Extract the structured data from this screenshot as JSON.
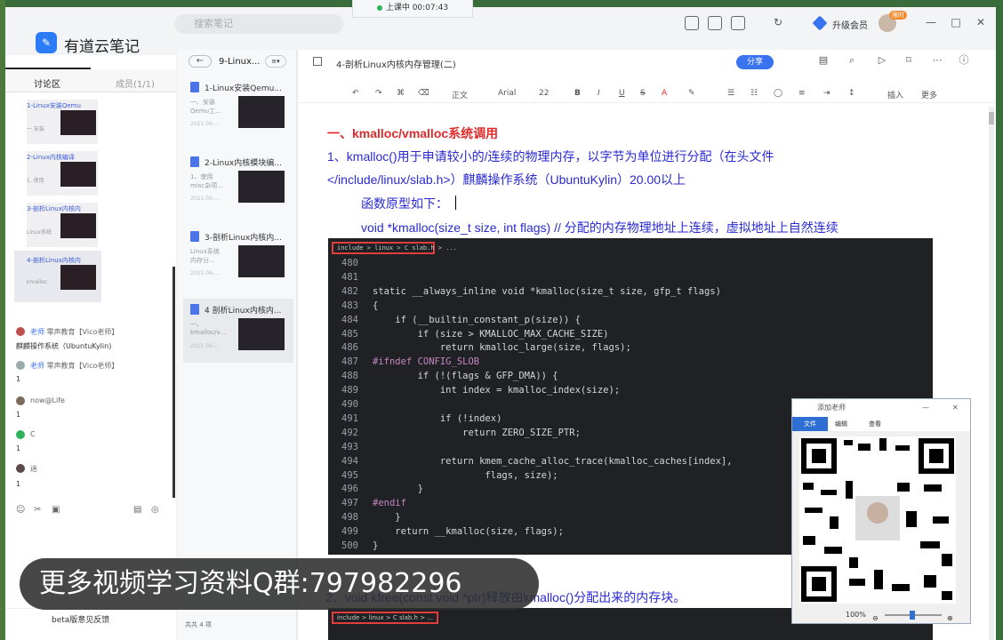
{
  "app": {
    "name": "有道云笔记",
    "search_placeholder": "搜索笔记"
  },
  "recording": {
    "label": "上课中 00:07:43"
  },
  "header": {
    "vip_label": "升级会员",
    "badge": "限时"
  },
  "sidebar": {
    "tabs": [
      {
        "label": "讨论区"
      },
      {
        "label": "成员(1/1)"
      }
    ],
    "thumbs": [
      {
        "title": "1-Linux安装Qemu",
        "sub": "一 安装"
      },
      {
        "title": "2-Linux内核编译",
        "sub": "1. 使用"
      },
      {
        "title": "3-剖析Linux内核内",
        "sub": "Linux系统"
      },
      {
        "title": "4-剖析Linux内核内",
        "sub": "kmalloc"
      }
    ],
    "chat": [
      {
        "name": "老师",
        "org": "零声教育【Vico老师】",
        "text": "麒麟操作系统（UbuntuKylin)"
      },
      {
        "name": "老师",
        "org": "零声教育【Vico老师】",
        "text": "1"
      },
      {
        "name": "now@Life",
        "org": "",
        "text": "1"
      },
      {
        "name": "C",
        "org": "",
        "text": "1"
      },
      {
        "name": "迷",
        "org": "",
        "text": "1"
      }
    ],
    "feedback": "beta版意见反馈"
  },
  "list": {
    "folder": "9-Linux...",
    "docs": [
      {
        "title": "1-Linux安装Qemu...",
        "l1": "一、安装",
        "l2": "Qemu工...",
        "date": "2021-05-..."
      },
      {
        "title": "2-Linux内核模块编...",
        "l1": "1、使用",
        "l2": "misc杂项...",
        "date": "2021-05-..."
      },
      {
        "title": "3-剖析Linux内核内...",
        "l1": "Linux系统",
        "l2": "内存分...",
        "date": "2021-06-..."
      },
      {
        "title": "4 剖析Linux内核内...",
        "l1": "一、",
        "l2": "kmalloc/v...",
        "date": "2021-06-..."
      }
    ],
    "count": "共共 4 项"
  },
  "editor": {
    "title": "4-剖析Linux内核内存管理(二)",
    "share": "分享",
    "toolbar": {
      "style": "正文",
      "font": "Arial",
      "size": "22",
      "insert": "插入",
      "more": "更多"
    },
    "heading": "一、kmalloc/vmalloc系统调用",
    "line1": "1、kmalloc()用于申请较小的/连续的物理内存，以字节为单位进行分配（在头文件",
    "line2": "</include/linux/slab.h>）麒麟操作系统（UbuntuKylin）20.00以上",
    "line3": "函数原型如下：",
    "line4": "void *kmalloc(size_t size, int flags)        // 分配的内存物理地址上连续，虚拟地址上自然连续",
    "bottom": "2、void kfree(const void *ptr)释放由kmalloc()分配出来的内存块。",
    "crumb": "include > linux > C slab.h > ...",
    "code_lines": [
      {
        "n": "480",
        "t": ""
      },
      {
        "n": "481",
        "t": ""
      },
      {
        "n": "482",
        "t": "static __always_inline void *kmalloc(size_t size, gfp_t flags)"
      },
      {
        "n": "483",
        "t": "{"
      },
      {
        "n": "484",
        "t": "    if (__builtin_constant_p(size)) {"
      },
      {
        "n": "485",
        "t": "        if (size > KMALLOC_MAX_CACHE_SIZE)"
      },
      {
        "n": "486",
        "t": "            return kmalloc_large(size, flags);"
      },
      {
        "n": "487",
        "t": "#ifndef CONFIG_SLOB"
      },
      {
        "n": "488",
        "t": "        if (!(flags & GFP_DMA)) {"
      },
      {
        "n": "489",
        "t": "            int index = kmalloc_index(size);"
      },
      {
        "n": "490",
        "t": ""
      },
      {
        "n": "491",
        "t": "            if (!index)"
      },
      {
        "n": "492",
        "t": "                return ZERO_SIZE_PTR;"
      },
      {
        "n": "493",
        "t": ""
      },
      {
        "n": "494",
        "t": "            return kmem_cache_alloc_trace(kmalloc_caches[index],"
      },
      {
        "n": "495",
        "t": "                    flags, size);"
      },
      {
        "n": "496",
        "t": "        }"
      },
      {
        "n": "497",
        "t": "#endif"
      },
      {
        "n": "498",
        "t": "    }"
      },
      {
        "n": "499",
        "t": "    return __kmalloc(size, flags);"
      },
      {
        "n": "500",
        "t": "}"
      }
    ]
  },
  "qr_window": {
    "title": "添加老师",
    "menu": [
      "文件",
      "编辑",
      "查看"
    ],
    "zoom": "100%"
  },
  "promo": {
    "text": "更多视频学习资料Q群:797982296"
  },
  "colors": {
    "accent": "#3a73f0",
    "heading": "#e02b2b",
    "body_text": "#2a2ad6",
    "code_bg": "#1f2125"
  }
}
